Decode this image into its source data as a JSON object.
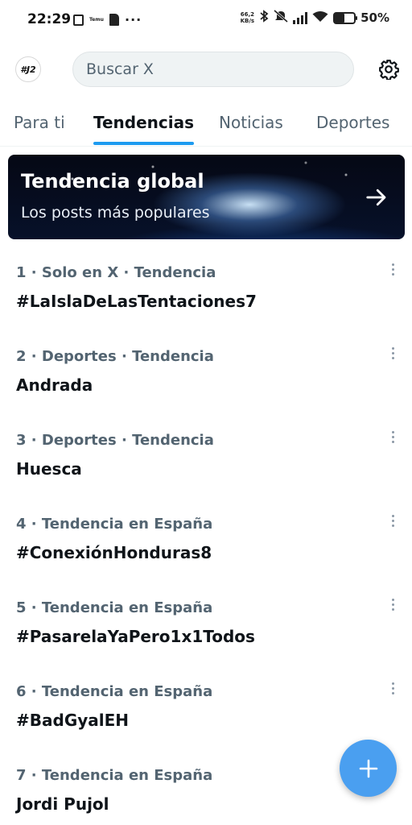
{
  "status_bar": {
    "time": "22:29",
    "temu_label": "Temu",
    "speed_value": "66,2",
    "speed_unit": "KB/s",
    "battery": "50%",
    "battery_level": 0.5
  },
  "header": {
    "avatar_text": "#J2",
    "search_placeholder": "Buscar X",
    "settings_icon": "gear-icon"
  },
  "tabs": [
    {
      "label": "Para ti",
      "active": false
    },
    {
      "label": "Tendencias",
      "active": true
    },
    {
      "label": "Noticias",
      "active": false
    },
    {
      "label": "Deportes",
      "active": false
    }
  ],
  "banner": {
    "title": "Tendencia global",
    "subtitle": "Los posts más populares",
    "icon": "arrow-right-icon"
  },
  "trends": [
    {
      "meta": "1 · Solo en X · Tendencia",
      "name": "#LaIslaDeLasTentaciones7"
    },
    {
      "meta": "2 · Deportes · Tendencia",
      "name": "Andrada"
    },
    {
      "meta": "3 · Deportes · Tendencia",
      "name": "Huesca"
    },
    {
      "meta": "4 · Tendencia en España",
      "name": "#ConexiónHonduras8"
    },
    {
      "meta": "5 · Tendencia en España",
      "name": "#PasarelaYaPero1x1Todos"
    },
    {
      "meta": "6 · Tendencia en España",
      "name": "#BadGyalEH"
    },
    {
      "meta": "7 · Tendencia en España",
      "name": "Jordi Pujol"
    }
  ],
  "fab": {
    "icon": "plus-icon"
  },
  "colors": {
    "accent": "#1d9bf0",
    "fab": "#4a9ff0",
    "secondary_text": "#536471"
  }
}
